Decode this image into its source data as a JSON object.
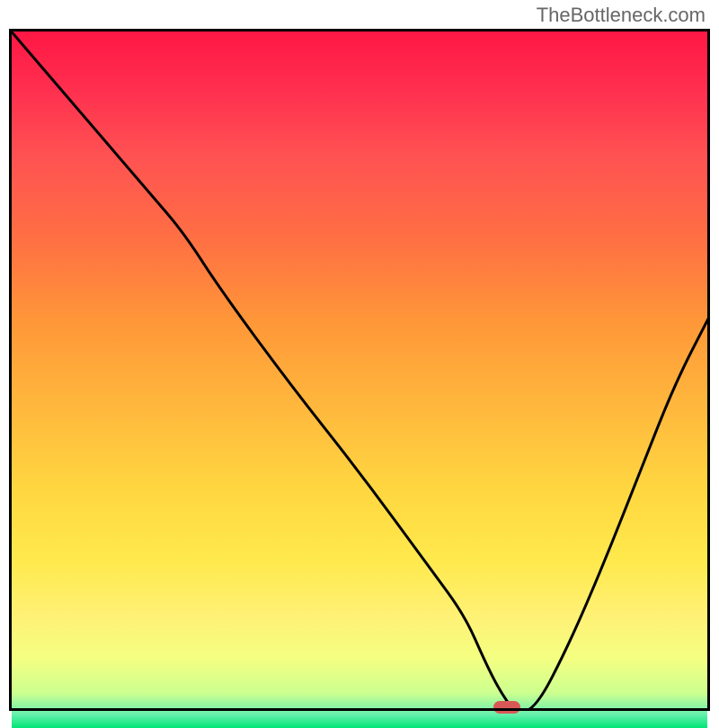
{
  "watermark": "TheBottleneck.com",
  "chart_data": {
    "type": "line",
    "title": "",
    "xlabel": "",
    "ylabel": "",
    "xlim": [
      0,
      100
    ],
    "ylim": [
      0,
      100
    ],
    "x": [
      0,
      10,
      20,
      25,
      30,
      40,
      50,
      60,
      65,
      68,
      70,
      72,
      75,
      80,
      85,
      90,
      95,
      100
    ],
    "values": [
      100,
      88,
      76,
      70,
      62,
      48,
      35,
      21,
      14,
      7,
      3,
      0,
      0,
      10,
      22,
      35,
      48,
      58
    ],
    "marker_x": 71,
    "marker_y": 0.5,
    "gradient_colors": [
      "#ff1744",
      "#ff5252",
      "#ff8a50",
      "#ffab40",
      "#ffd740",
      "#ffee58",
      "#fff59d",
      "#f4ff81",
      "#ccff90",
      "#69f0ae",
      "#00e676"
    ],
    "note": "V-shaped bottleneck curve with minimum around x=70-75; background is vertical gradient from red (top) through orange/yellow to green (bottom)"
  }
}
